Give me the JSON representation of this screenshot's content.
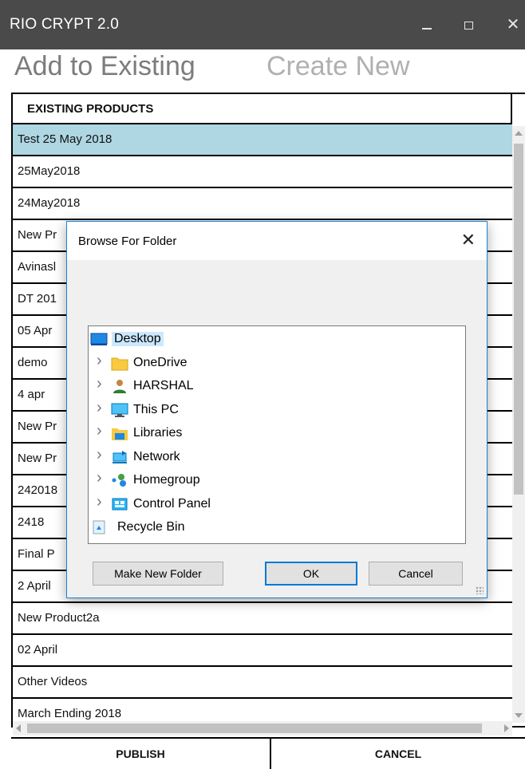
{
  "window": {
    "title": "RIO CRYPT 2.0"
  },
  "tabs": {
    "add_existing": "Add to Existing",
    "create_new": "Create New"
  },
  "list": {
    "header": "EXISTING PRODUCTS",
    "rows": [
      "Test 25 May 2018",
      "25May2018",
      "24May2018",
      "New Pr",
      "Avinasl",
      "DT 201",
      "05 Apr",
      "demo",
      "4 apr",
      "New Pr",
      "New Pr",
      "242018",
      "2418",
      "Final P",
      "2 April",
      "New Product2a",
      "02 April",
      "Other Videos",
      "March Ending 2018"
    ]
  },
  "footer": {
    "publish": "PUBLISH",
    "cancel": "CANCEL"
  },
  "dialog": {
    "title": "Browse For Folder",
    "tree": [
      {
        "label": "Desktop",
        "icon": "desktop-icon",
        "expandable": false,
        "selected": true
      },
      {
        "label": "OneDrive",
        "icon": "folder-icon",
        "expandable": true
      },
      {
        "label": "HARSHAL",
        "icon": "user-icon",
        "expandable": true
      },
      {
        "label": "This PC",
        "icon": "computer-icon",
        "expandable": true
      },
      {
        "label": "Libraries",
        "icon": "libraries-icon",
        "expandable": true
      },
      {
        "label": "Network",
        "icon": "network-icon",
        "expandable": true
      },
      {
        "label": "Homegroup",
        "icon": "homegroup-icon",
        "expandable": true
      },
      {
        "label": "Control Panel",
        "icon": "control-panel-icon",
        "expandable": true
      },
      {
        "label": "Recycle Bin",
        "icon": "recycle-bin-icon",
        "expandable": false
      }
    ],
    "buttons": {
      "make_new_folder": "Make New Folder",
      "ok": "OK",
      "cancel": "Cancel"
    }
  },
  "colors": {
    "titlebar": "#4a4a4a",
    "selected_row": "#aed6e3",
    "dialog_border": "#1883d7",
    "tree_selection": "#cce8ff"
  }
}
